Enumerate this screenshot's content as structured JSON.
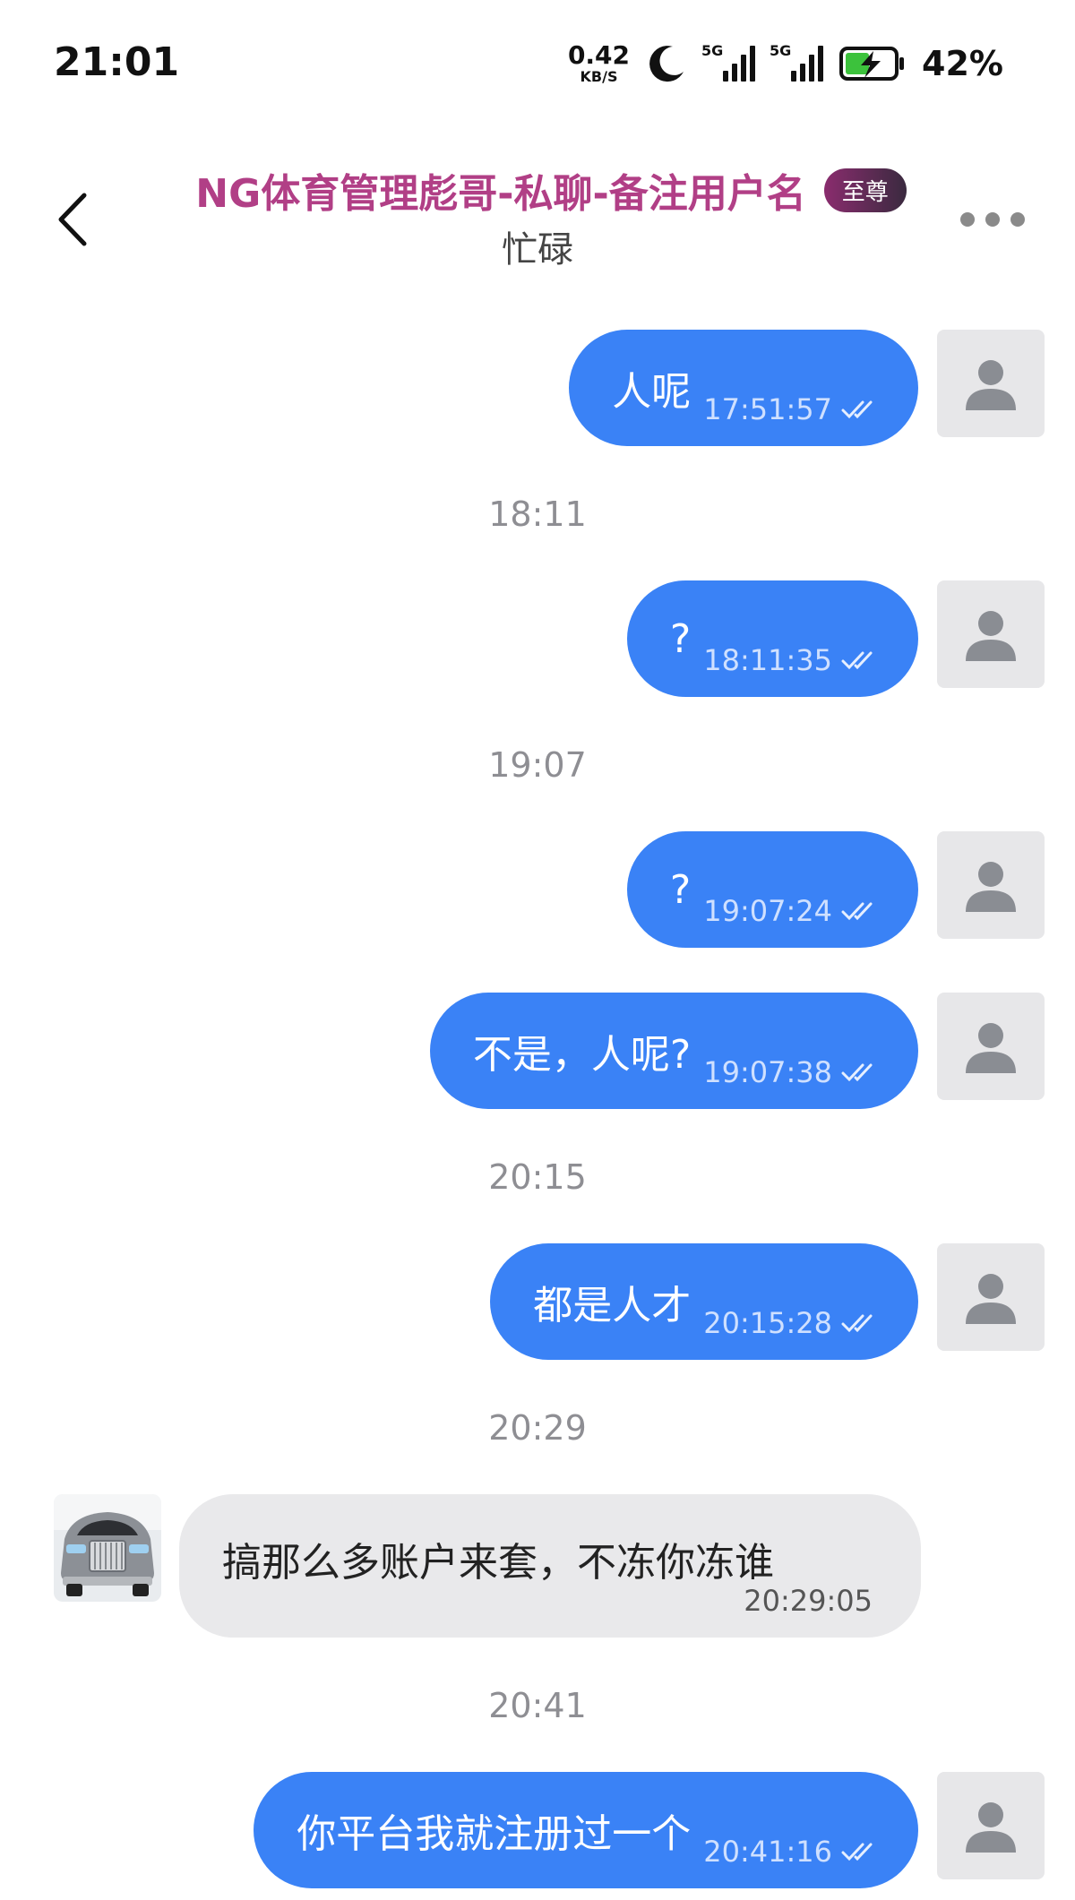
{
  "status_bar": {
    "time": "21:01",
    "net_speed_value": "0.42",
    "net_speed_unit": "KB/S",
    "sim1_label": "5G",
    "sim2_label": "5G",
    "battery": "42%"
  },
  "header": {
    "title": "NG体育管理彪哥-私聊-备注用户名",
    "badge": "至尊",
    "status": "忙碌"
  },
  "messages": [
    {
      "type": "out",
      "text": "人呢",
      "time": "17:51:57"
    },
    {
      "type": "separator",
      "text": "18:11"
    },
    {
      "type": "out",
      "text": "?",
      "time": "18:11:35"
    },
    {
      "type": "separator",
      "text": "19:07"
    },
    {
      "type": "out",
      "text": "?",
      "time": "19:07:24"
    },
    {
      "type": "out",
      "text": "不是，人呢?",
      "time": "19:07:38"
    },
    {
      "type": "separator",
      "text": "20:15"
    },
    {
      "type": "out",
      "text": "都是人才",
      "time": "20:15:28"
    },
    {
      "type": "separator",
      "text": "20:29"
    },
    {
      "type": "in",
      "text": "搞那么多账户来套，不冻你冻谁",
      "time": "20:29:05"
    },
    {
      "type": "separator",
      "text": "20:41"
    },
    {
      "type": "out",
      "text": "你平台我就注册过一个",
      "time": "20:41:16"
    }
  ],
  "colors": {
    "accent": "#3a82f6",
    "title": "#b13f86",
    "incoming_bubble": "#e9e9eb"
  }
}
